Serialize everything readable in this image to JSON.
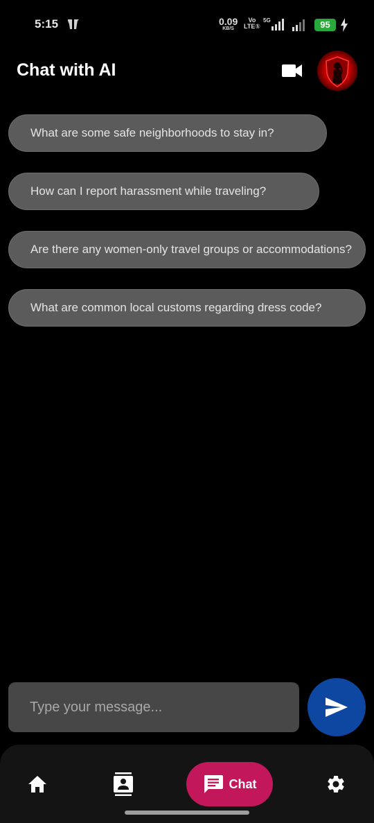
{
  "status_bar": {
    "time": "5:15",
    "net_speed_value": "0.09",
    "net_speed_unit": "KB/S",
    "volte_top": "Vo",
    "volte_bottom": "LTE①",
    "network_type": "5G",
    "battery": "95"
  },
  "app_bar": {
    "title": "Chat with AI",
    "video_icon": "videocam-icon",
    "avatar_icon": "shield-avatar-icon"
  },
  "suggestions": [
    "What are some safe neighborhoods to stay in?",
    "How can I report harassment while traveling?",
    "Are there any women-only travel groups or accommodations?",
    "What are common local customs regarding dress code?"
  ],
  "composer": {
    "placeholder": "Type your message...",
    "send_icon": "send-icon"
  },
  "bottom_nav": {
    "items": [
      {
        "icon": "home-icon",
        "label": ""
      },
      {
        "icon": "contacts-icon",
        "label": ""
      },
      {
        "icon": "chat-icon",
        "label": "Chat"
      },
      {
        "icon": "gear-icon",
        "label": ""
      }
    ],
    "active_index": 2
  },
  "colors": {
    "background": "#000000",
    "chip_bg": "#5b5b5b",
    "input_bg": "#474747",
    "send_button": "#0d47a1",
    "nav_active": "#c2185b",
    "nav_bg": "#141414",
    "battery": "#29a83b"
  }
}
